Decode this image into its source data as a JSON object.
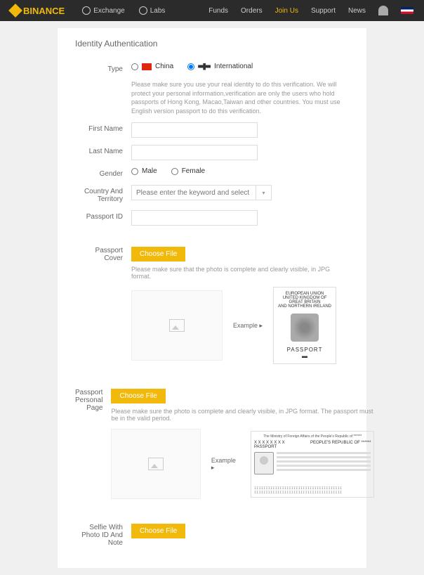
{
  "header": {
    "brand": "BINANCE",
    "nav_left": {
      "exchange": "Exchange",
      "labs": "Labs"
    },
    "nav_right": {
      "funds": "Funds",
      "orders": "Orders",
      "join": "Join Us",
      "support": "Support",
      "news": "News"
    }
  },
  "page": {
    "title": "Identity Authentication"
  },
  "form": {
    "type_label": "Type",
    "type_china": "China",
    "type_intl": "International",
    "notice": "Please make sure you use your real identity to do this verification. We will protect your personal information,verification are only the users who hold passports of Hong Kong, Macao,Taiwan and other countries. You must use English version passport to do this verification.",
    "first_name": "First Name",
    "last_name": "Last Name",
    "gender_label": "Gender",
    "gender_male": "Male",
    "gender_female": "Female",
    "country_label": "Country And Territory",
    "country_placeholder": "Please enter the keyword and select",
    "passport_id": "Passport ID"
  },
  "uploads": {
    "cover_label": "Passport Cover",
    "choose_file": "Choose File",
    "cover_hint": "Please make sure that the photo is complete and clearly visible, in JPG format.",
    "example": "Example",
    "cover_sample": {
      "l1": "EUROPEAN UNION",
      "l2": "UNITED KINGDOM OF",
      "l3": "GREAT BRITAIN",
      "l4": "AND NORTHERN IRELAND",
      "pt": "PASSPORT"
    },
    "personal_label": "Passport Personal Page",
    "personal_hint": "Please make sure the photo is complete and clearly visible, in JPG format. The passport must be in the valid period.",
    "page_sample": {
      "hdr": "The Ministry of Foreign Affairs of the People's Republic of ******",
      "p1": "PASSPORT",
      "p2": "PEOPLE'S REPUBLIC OF ******"
    },
    "selfie_label": "Selfie With Photo ID And Note"
  }
}
